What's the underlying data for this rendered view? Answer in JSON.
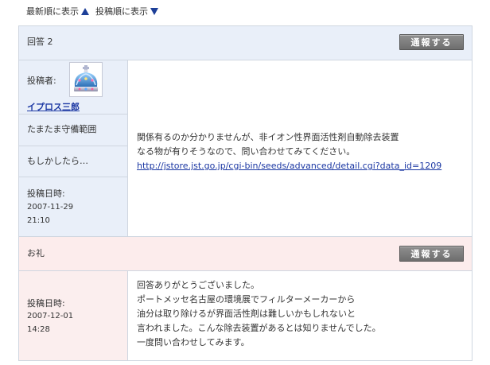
{
  "sort": {
    "newest_label": "最新順に表示",
    "posted_label": "投稿順に表示"
  },
  "answer": {
    "title": "回答 2",
    "report_label": "通報する",
    "poster_label": "投稿者:",
    "poster_name": "イプロス三郎",
    "affiliation": "たまたま守備範囲",
    "confidence": "もしかしたら…",
    "date_label": "投稿日時:",
    "date": "2007-11-29",
    "time": "21:10",
    "body_line1": "関係有るのか分かりませんが、非イオン性界面活性剤自動除去装置",
    "body_line2": "なる物が有りそうなので、問い合わせてみてください。",
    "link": "http://jstore.jst.go.jp/cgi-bin/seeds/advanced/detail.cgi?data_id=1209"
  },
  "thanks": {
    "title": "お礼",
    "report_label": "通報する",
    "date_label": "投稿日時:",
    "date": "2007-12-01",
    "time": "14:28",
    "lines": [
      "回答ありがとうございました。",
      "ポートメッセ名古屋の環境展でフィルターメーカーから",
      "油分は取り除けるが界面活性剤は難しいかもしれないと",
      "言われました。こんな除去装置があるとは知りませんでした。",
      "一度問い合わせしてみます。"
    ]
  },
  "colors": {
    "header_blue": "#e9eff9",
    "header_pink": "#fcecec",
    "link": "#1b37a3",
    "arrow": "#1d3f98"
  }
}
